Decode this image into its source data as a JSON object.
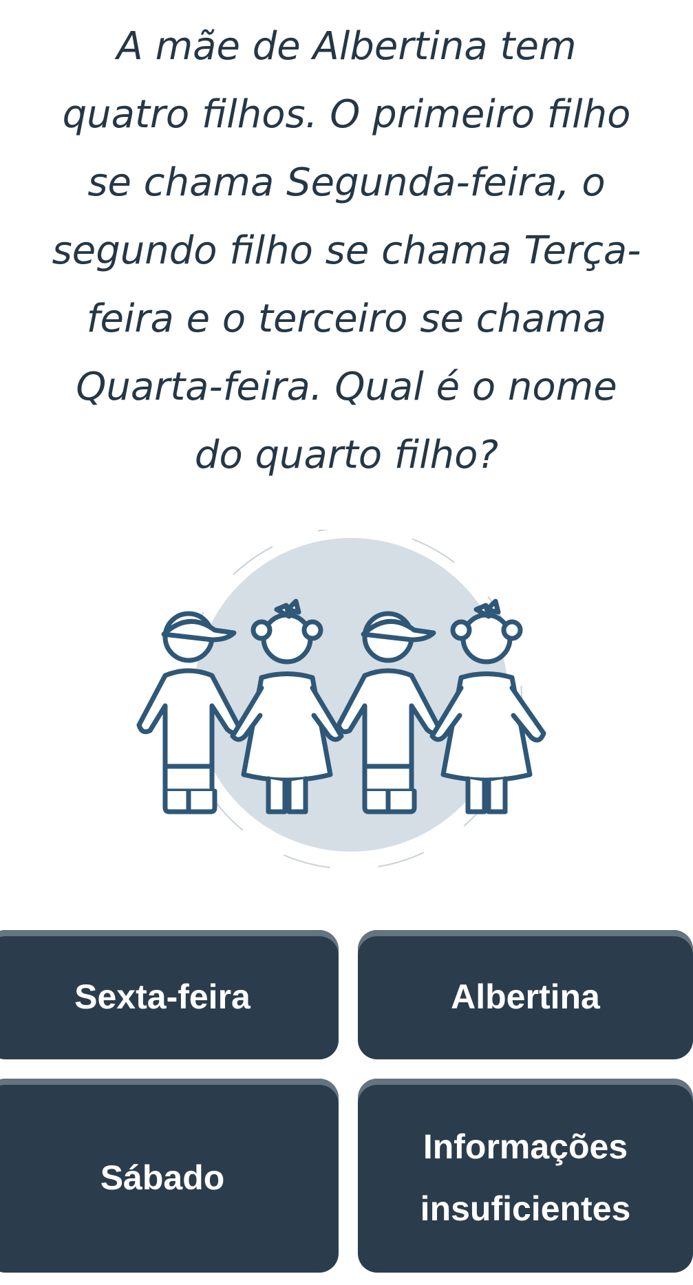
{
  "question": {
    "lines": [
      "A mãe de Albertina tem",
      "quatro filhos. O primeiro filho",
      "se chama Segunda-feira, o",
      "segundo filho se chama Terça-",
      "feira e o terceiro se chama",
      "Quarta-feira. Qual é o nome",
      "do quarto filho?"
    ]
  },
  "illustration": {
    "icon": "four-children-icon",
    "colors": {
      "outline": "#2f5777",
      "circle": "#d5dee5",
      "dashed_ring": "#c9d2d9"
    }
  },
  "answers": [
    {
      "label": "Sexta-feira"
    },
    {
      "label": "Albertina"
    },
    {
      "label": "Sábado"
    },
    {
      "label": "Informações insuficientes"
    }
  ],
  "colors": {
    "text": "#253746",
    "button_bg": "#2b3d4c",
    "button_top_edge": "#647480",
    "button_text": "#ffffff"
  }
}
